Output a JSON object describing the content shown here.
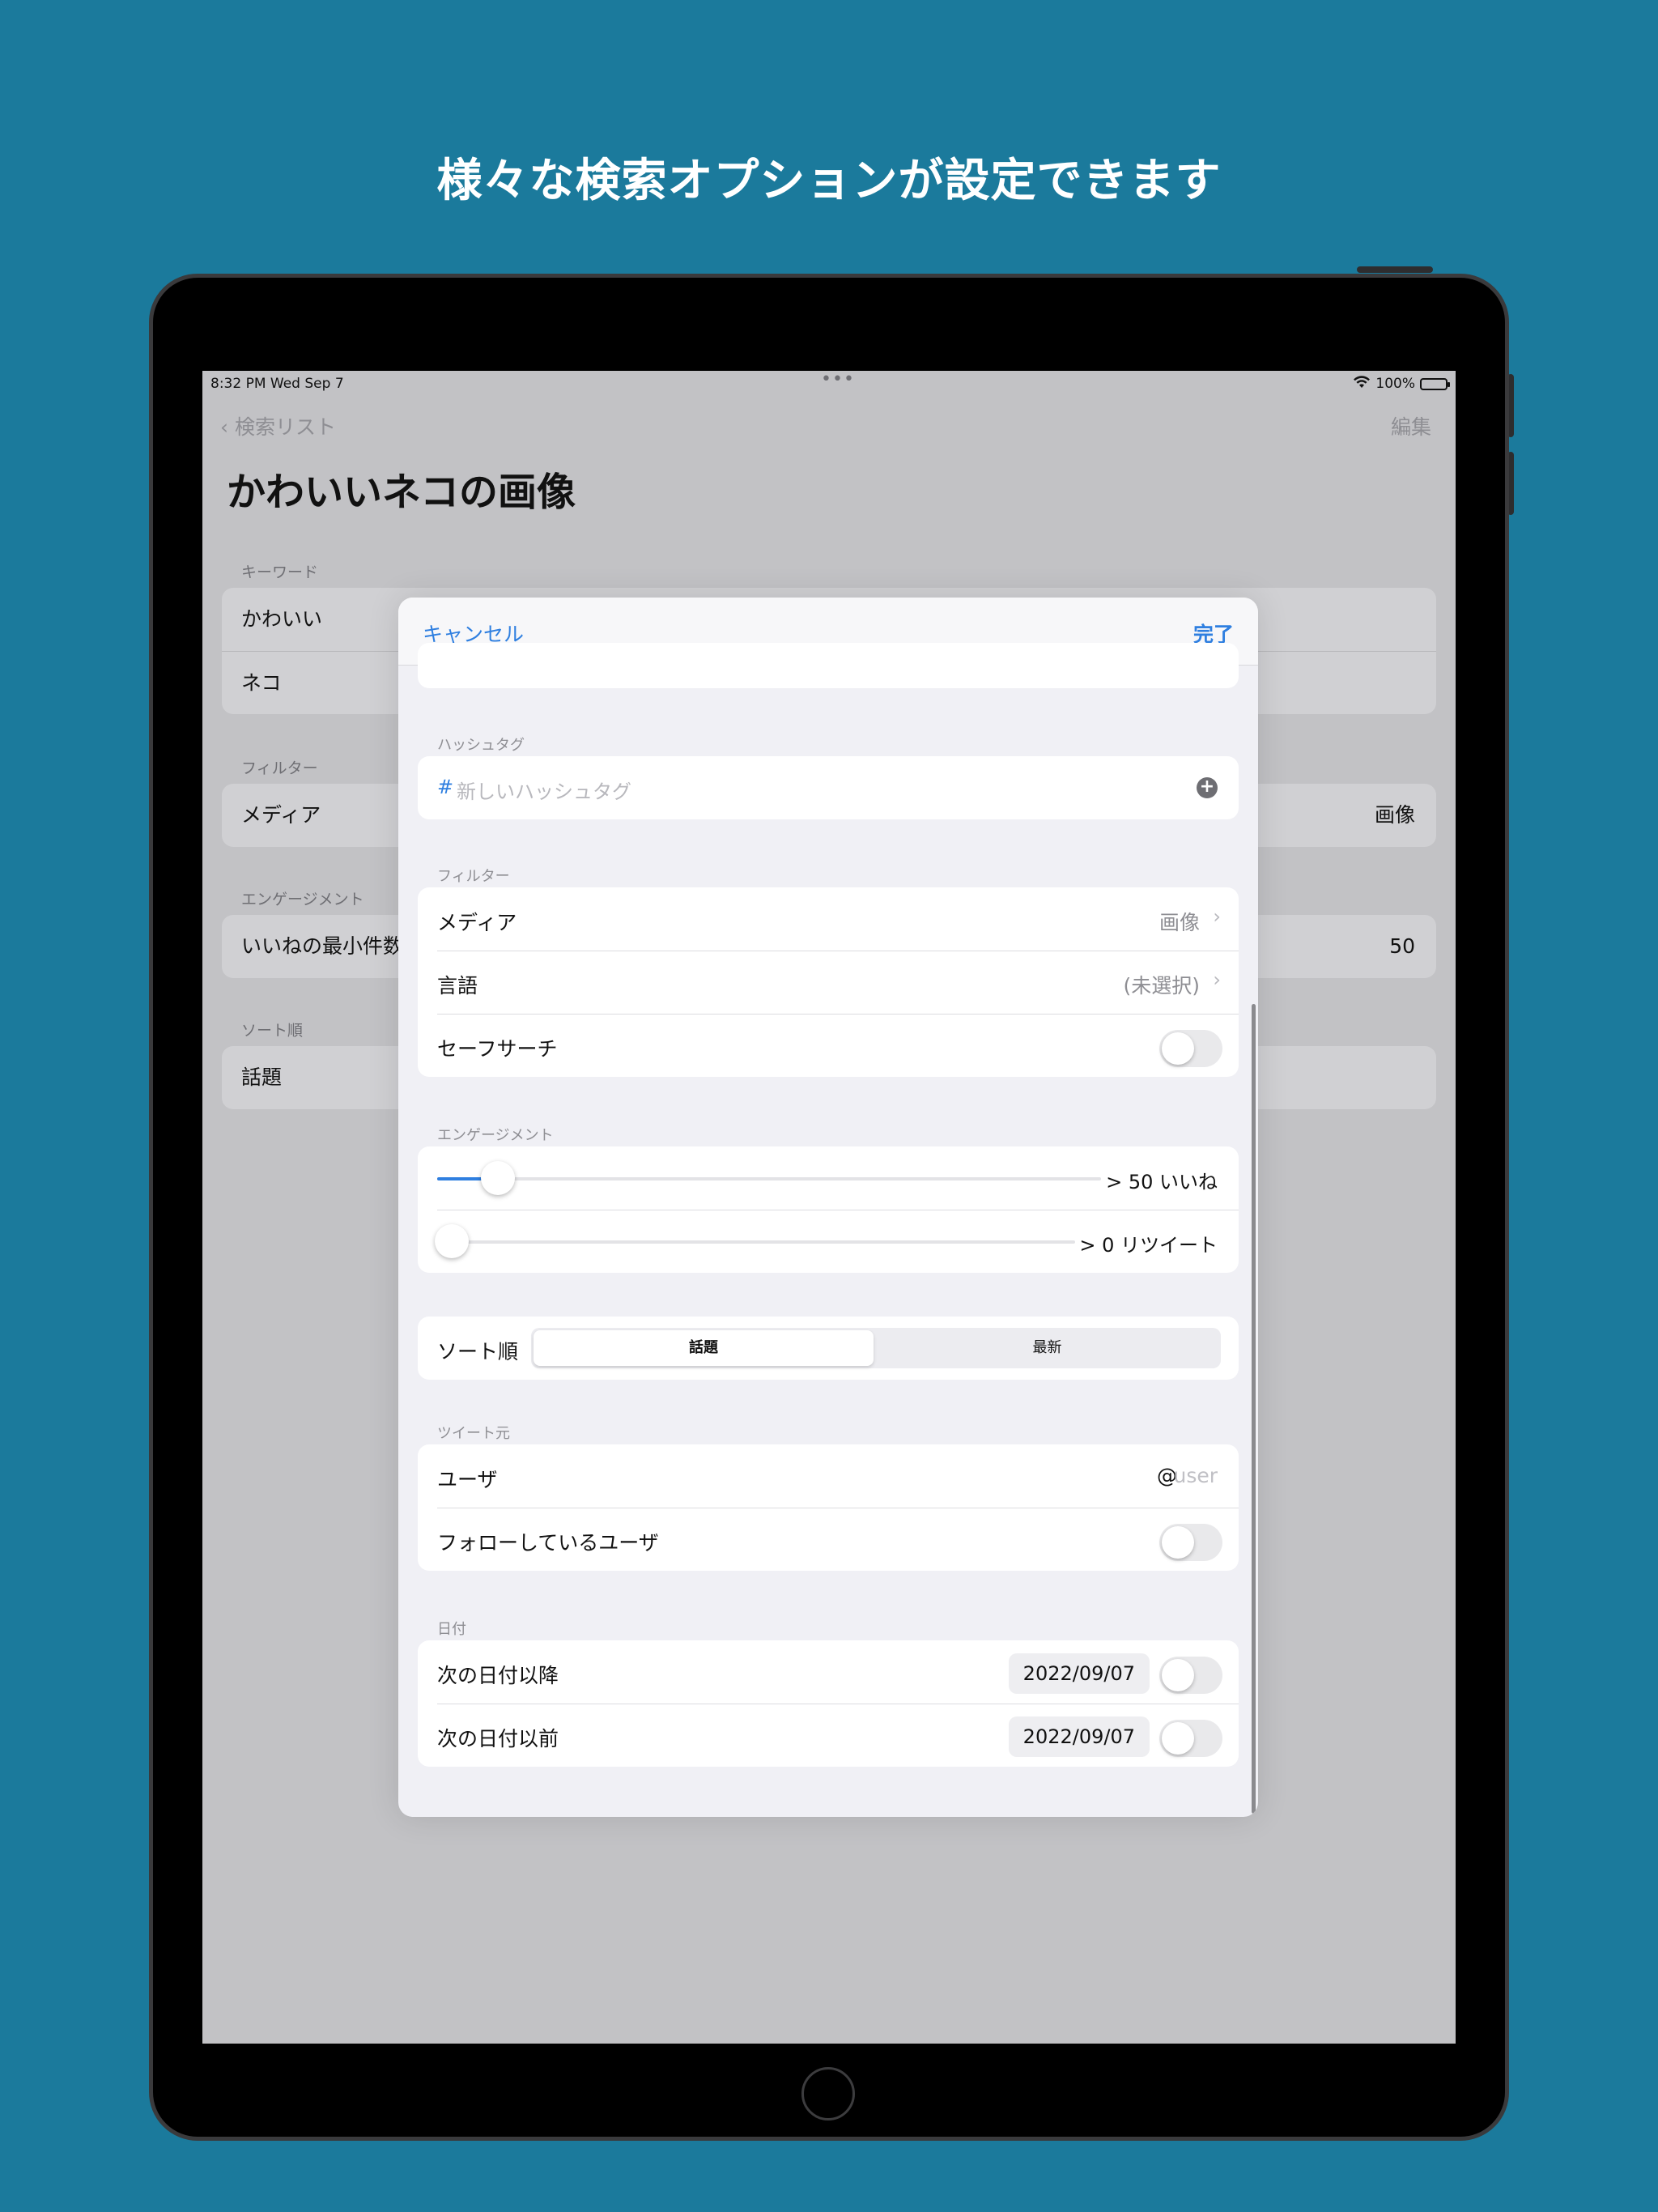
{
  "headline": "様々な検索オプションが設定できます",
  "status_bar": {
    "time": "8:32 PM   Wed Sep 7",
    "dots": "•••",
    "wifi": "wifi-icon",
    "battery": "100%"
  },
  "background_screen": {
    "back_label": "検索リスト",
    "edit_label": "編集",
    "title": "かわいいネコの画像",
    "sections": [
      {
        "header": "キーワード",
        "rows": [
          {
            "label": "かわいい"
          },
          {
            "label": "ネコ"
          }
        ]
      },
      {
        "header": "フィルター",
        "rows": [
          {
            "label": "メディア",
            "value": "画像"
          }
        ]
      },
      {
        "header": "エンゲージメント",
        "rows": [
          {
            "label": "いいねの最小件数",
            "value": "50"
          }
        ]
      },
      {
        "header": "ソート順",
        "rows": [
          {
            "label": "話題"
          }
        ]
      }
    ]
  },
  "modal": {
    "cancel_label": "キャンセル",
    "done_label": "完了",
    "hashtag": {
      "header": "ハッシュタグ",
      "symbol": "#",
      "placeholder": "新しいハッシュタグ",
      "add_icon": "plus-circle-icon"
    },
    "filter": {
      "header": "フィルター",
      "media_label": "メディア",
      "media_value": "画像",
      "language_label": "言語",
      "language_value": "(未選択)",
      "safesearch_label": "セーフサーチ",
      "safesearch_on": false
    },
    "engagement": {
      "header": "エンゲージメント",
      "likes_label": "> 50 いいね",
      "likes_fraction": 0.07,
      "retweets_label": "> 0 リツイート",
      "retweets_fraction": 0.0
    },
    "sort": {
      "label": "ソート順",
      "options": [
        "話題",
        "最新"
      ],
      "selected": "話題"
    },
    "source": {
      "header": "ツイート元",
      "user_label": "ユーザ",
      "user_prefix": "@",
      "user_placeholder": "user",
      "following_label": "フォローしているユーザ",
      "following_on": false
    },
    "date": {
      "header": "日付",
      "since_label": "次の日付以降",
      "since_value": "2022/09/07",
      "since_on": false,
      "until_label": "次の日付以前",
      "until_value": "2022/09/07",
      "until_on": false
    }
  },
  "colors": {
    "background": "#1b7a9c",
    "accent": "#2f7fe0"
  }
}
